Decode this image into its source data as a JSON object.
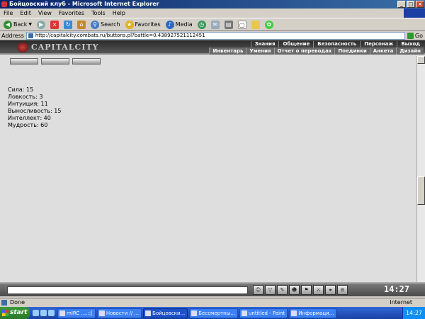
{
  "window": {
    "title": "Бойцовский клуб - Microsoft Internet Explorer"
  },
  "menu": [
    "File",
    "Edit",
    "View",
    "Favorites",
    "Tools",
    "Help"
  ],
  "toolbar": {
    "back": "Back",
    "search": "Search",
    "favorites": "Favorites",
    "media": "Media"
  },
  "address": {
    "label": "Address",
    "url": "http://capitalcity.combats.ru/buttons.pl?battle=0.438927521112451",
    "go": "Go"
  },
  "site": {
    "logo": "CAPITALCITY",
    "nav_top": [
      "Знания",
      "Общение",
      "Безопасность",
      "Персонаж",
      "Выход"
    ],
    "nav_bottom": [
      "Инвентарь",
      "Умения",
      "Отчет о переводах",
      "Поединки",
      "Анкета",
      "Дизайн"
    ]
  },
  "stats": [
    "Сила: 15",
    "Ловкость: 3",
    "Интуиция: 11",
    "Выносливость: 15",
    "Интеллект: 40",
    "Мудрость: 60"
  ],
  "clock": "14:27",
  "status": {
    "left": "Done",
    "zone": "Internet"
  },
  "taskbar": {
    "start": "start",
    "tasks": [
      "mIRC ....::[",
      "Новости // ...",
      "Бойцовски...",
      "Бессмертны...",
      "untitled - Paint",
      "Информаци..."
    ],
    "active_index": 2,
    "time": "14:27"
  }
}
